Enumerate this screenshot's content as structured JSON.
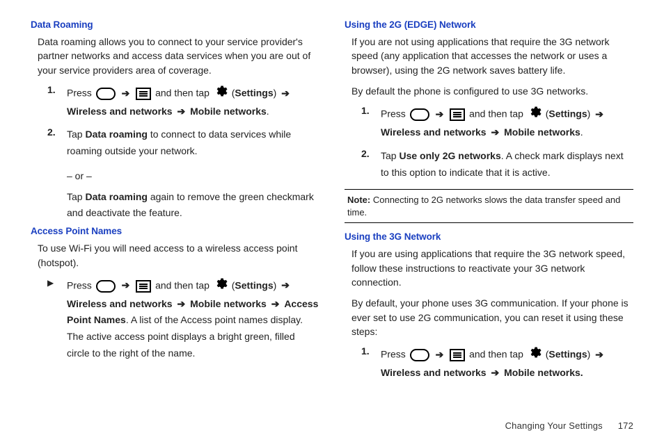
{
  "left": {
    "dataRoaming": {
      "heading": "Data Roaming",
      "intro": "Data roaming allows you to connect to your service provider's partner networks and access data services when you are out of your service providers area of coverage.",
      "step1_num": "1.",
      "step1_press": "Press",
      "step1_andthen": "and then tap",
      "step1_settings": "Settings",
      "step1_wireless": "Wireless and networks",
      "step1_mobile": "Mobile networks",
      "step2_num": "2.",
      "step2_tap": "Tap",
      "step2_bold": "Data roaming",
      "step2_rest": "to connect to data services while roaming outside your network.",
      "or": "– or –",
      "step2b_tap": "Tap",
      "step2b_bold": "Data roaming",
      "step2b_rest": "again to remove the green checkmark and deactivate the feature."
    },
    "apn": {
      "heading": "Access Point Names",
      "intro": "To use Wi-Fi you will need access to a wireless access point (hotspot).",
      "bullet": "▶",
      "press": "Press",
      "andthen": "and then tap",
      "settings": "Settings",
      "wireless": "Wireless and networks",
      "mobile": "Mobile networks",
      "apnlabel": "Access Point Names",
      "rest": ". A list of the Access point names display. The active access point displays a bright green, filled circle to the right of the name."
    }
  },
  "right": {
    "edge": {
      "heading": "Using the 2G (EDGE) Network",
      "intro": "If you are not using applications that require the 3G network speed (any application that accesses the network or uses a browser), using the 2G network saves battery life.",
      "default": "By default the phone is configured to use 3G networks.",
      "step1_num": "1.",
      "step1_press": "Press",
      "step1_andthen": "and then tap",
      "step1_settings": "Settings",
      "step1_wireless": "Wireless and networks",
      "step1_mobile": "Mobile networks",
      "step2_num": "2.",
      "step2_tap": "Tap",
      "step2_bold": "Use only 2G networks",
      "step2_rest": ". A check mark displays next to this option to indicate that it is active."
    },
    "note": {
      "label": "Note:",
      "text": "Connecting to 2G networks slows the data transfer speed and time."
    },
    "g3": {
      "heading": "Using the 3G Network",
      "intro": "If you are using applications that require the 3G network speed, follow these instructions to reactivate your 3G network connection.",
      "default": "By default, your phone uses 3G communication. If your phone is ever set to use 2G communication, you can reset it using these steps:",
      "step1_num": "1.",
      "step1_press": "Press",
      "step1_andthen": "and then tap",
      "step1_settings": "Settings",
      "step1_wireless": "Wireless and networks",
      "step1_mobile": "Mobile networks."
    }
  },
  "footer": {
    "section": "Changing Your Settings",
    "page": "172"
  },
  "glyphs": {
    "arrow": "➔"
  }
}
